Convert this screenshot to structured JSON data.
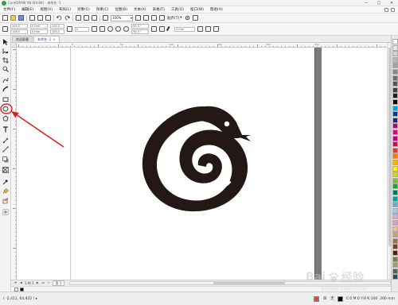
{
  "window": {
    "title": "CorelDRAW X8 (64-Bit) - 未命名 -1",
    "controls": [
      "—",
      "□",
      "✕"
    ]
  },
  "menu": {
    "items": [
      "文件(F)",
      "编辑(E)",
      "视图(V)",
      "布局(L)",
      "对象(C)",
      "效果(C)",
      "位图(B)",
      "文本(X)",
      "表格(T)",
      "工具(O)",
      "窗口(W)",
      "帮助(H)"
    ]
  },
  "toolbar": {
    "zoom_value": "100%",
    "snap_label": "贴齐(T)"
  },
  "property_bar": {
    "x_value": "105.0",
    "y_value": "148.5",
    "w_value": "0 mm",
    "h_value": "0 mm",
    "scale_w": "100.0",
    "scale_h": "100.0",
    "angle": "0",
    "start_angle": "90.0 °",
    "end_angle": "90.0 °",
    "outline_width": "2 mm"
  },
  "tabs": [
    {
      "label": "欢迎屏幕",
      "active": false
    },
    {
      "label": "未命名 -1",
      "active": true
    }
  ],
  "page_nav": {
    "page_count": "1 的 1",
    "page_tab": "页 1"
  },
  "status": {
    "coordinates": "( -2,411, 64,822 ) ▸",
    "fill_label": "无",
    "outline_info": "C:0 M:0 Y:0 K:100  .200 mm"
  },
  "watermark": {
    "brand": "Bai",
    "brand_suffix": "经验",
    "url": "jingyan.baidu.com"
  },
  "ruler_h_labels": [
    "0",
    "50",
    "100",
    "150",
    "200",
    "250"
  ],
  "palette_colors": [
    "#ffffff",
    "#e8e8e8",
    "#d0d0d0",
    "#b8b8b8",
    "#a0a0a0",
    "#888888",
    "#707070",
    "#585858",
    "#404040",
    "#202020",
    "#000000",
    "#00a0e0",
    "#003c8c",
    "#1a2a6e",
    "#8c1a6e",
    "#e0007a",
    "#c0007a",
    "#e6003c",
    "#e83a1e",
    "#f07c00",
    "#f5b400",
    "#fff000",
    "#c8e000",
    "#80c020",
    "#20a040",
    "#007a50",
    "#00a0a0",
    "#60b0d0",
    "#a8c8e0",
    "#c8b0d8",
    "#d8a0c0",
    "#e8c0a0",
    "#c8a070",
    "#a07048",
    "#784020",
    "#502010",
    "#7a7a4a",
    "#9aa06a",
    "#4a6a4a",
    "#2a4a6a"
  ],
  "doc_palette": [
    "#ffffff",
    "#000000"
  ],
  "icons": {
    "titlebar": "coreldraw-logo-icon",
    "annotation": "red-circle-arrow-annotation"
  }
}
